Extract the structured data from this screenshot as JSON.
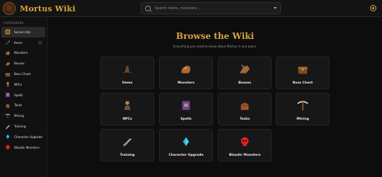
{
  "app": {
    "title": "Mortus Wiki"
  },
  "search": {
    "placeholder": "Search items, monsters..."
  },
  "sidebar": {
    "heading": "CATEGORIES",
    "items": [
      {
        "label": "Server Info",
        "icon": "book-icon",
        "active": true
      },
      {
        "label": "Items",
        "icon": "sword-icon",
        "expandable": true
      },
      {
        "label": "Monsters",
        "icon": "monster-icon"
      },
      {
        "label": "Bosses",
        "icon": "boss-icon"
      },
      {
        "label": "Boss Chest",
        "icon": "chest-icon"
      },
      {
        "label": "NPCs",
        "icon": "npc-icon"
      },
      {
        "label": "Spells",
        "icon": "spellbook-icon"
      },
      {
        "label": "Tasks",
        "icon": "task-icon"
      },
      {
        "label": "Mining",
        "icon": "pickaxe-icon"
      },
      {
        "label": "Training",
        "icon": "training-icon"
      },
      {
        "label": "Character Upgrade",
        "icon": "crystal-icon"
      },
      {
        "label": "Bloodic Monsters",
        "icon": "red-skull-icon"
      }
    ]
  },
  "main": {
    "title": "Browse the Wiki",
    "subtitle": "Everything you need to know about Mortus in one place.",
    "cards": [
      {
        "label": "Items",
        "icon": "hat-icon"
      },
      {
        "label": "Monsters",
        "icon": "monster-icon"
      },
      {
        "label": "Bosses",
        "icon": "boss-icon"
      },
      {
        "label": "Boss Chest",
        "icon": "chest-icon"
      },
      {
        "label": "NPCs",
        "icon": "npc-icon"
      },
      {
        "label": "Spells",
        "icon": "spellbook-icon"
      },
      {
        "label": "Tasks",
        "icon": "task-icon"
      },
      {
        "label": "Mining",
        "icon": "pickaxe-icon"
      },
      {
        "label": "Training",
        "icon": "training-icon"
      },
      {
        "label": "Character Upgrade",
        "icon": "crystal-icon"
      },
      {
        "label": "Bloodic Monsters",
        "icon": "red-skull-icon"
      }
    ]
  },
  "colors": {
    "accent": "#d9a441",
    "background": "#0d0d0d",
    "card": "#171717"
  }
}
